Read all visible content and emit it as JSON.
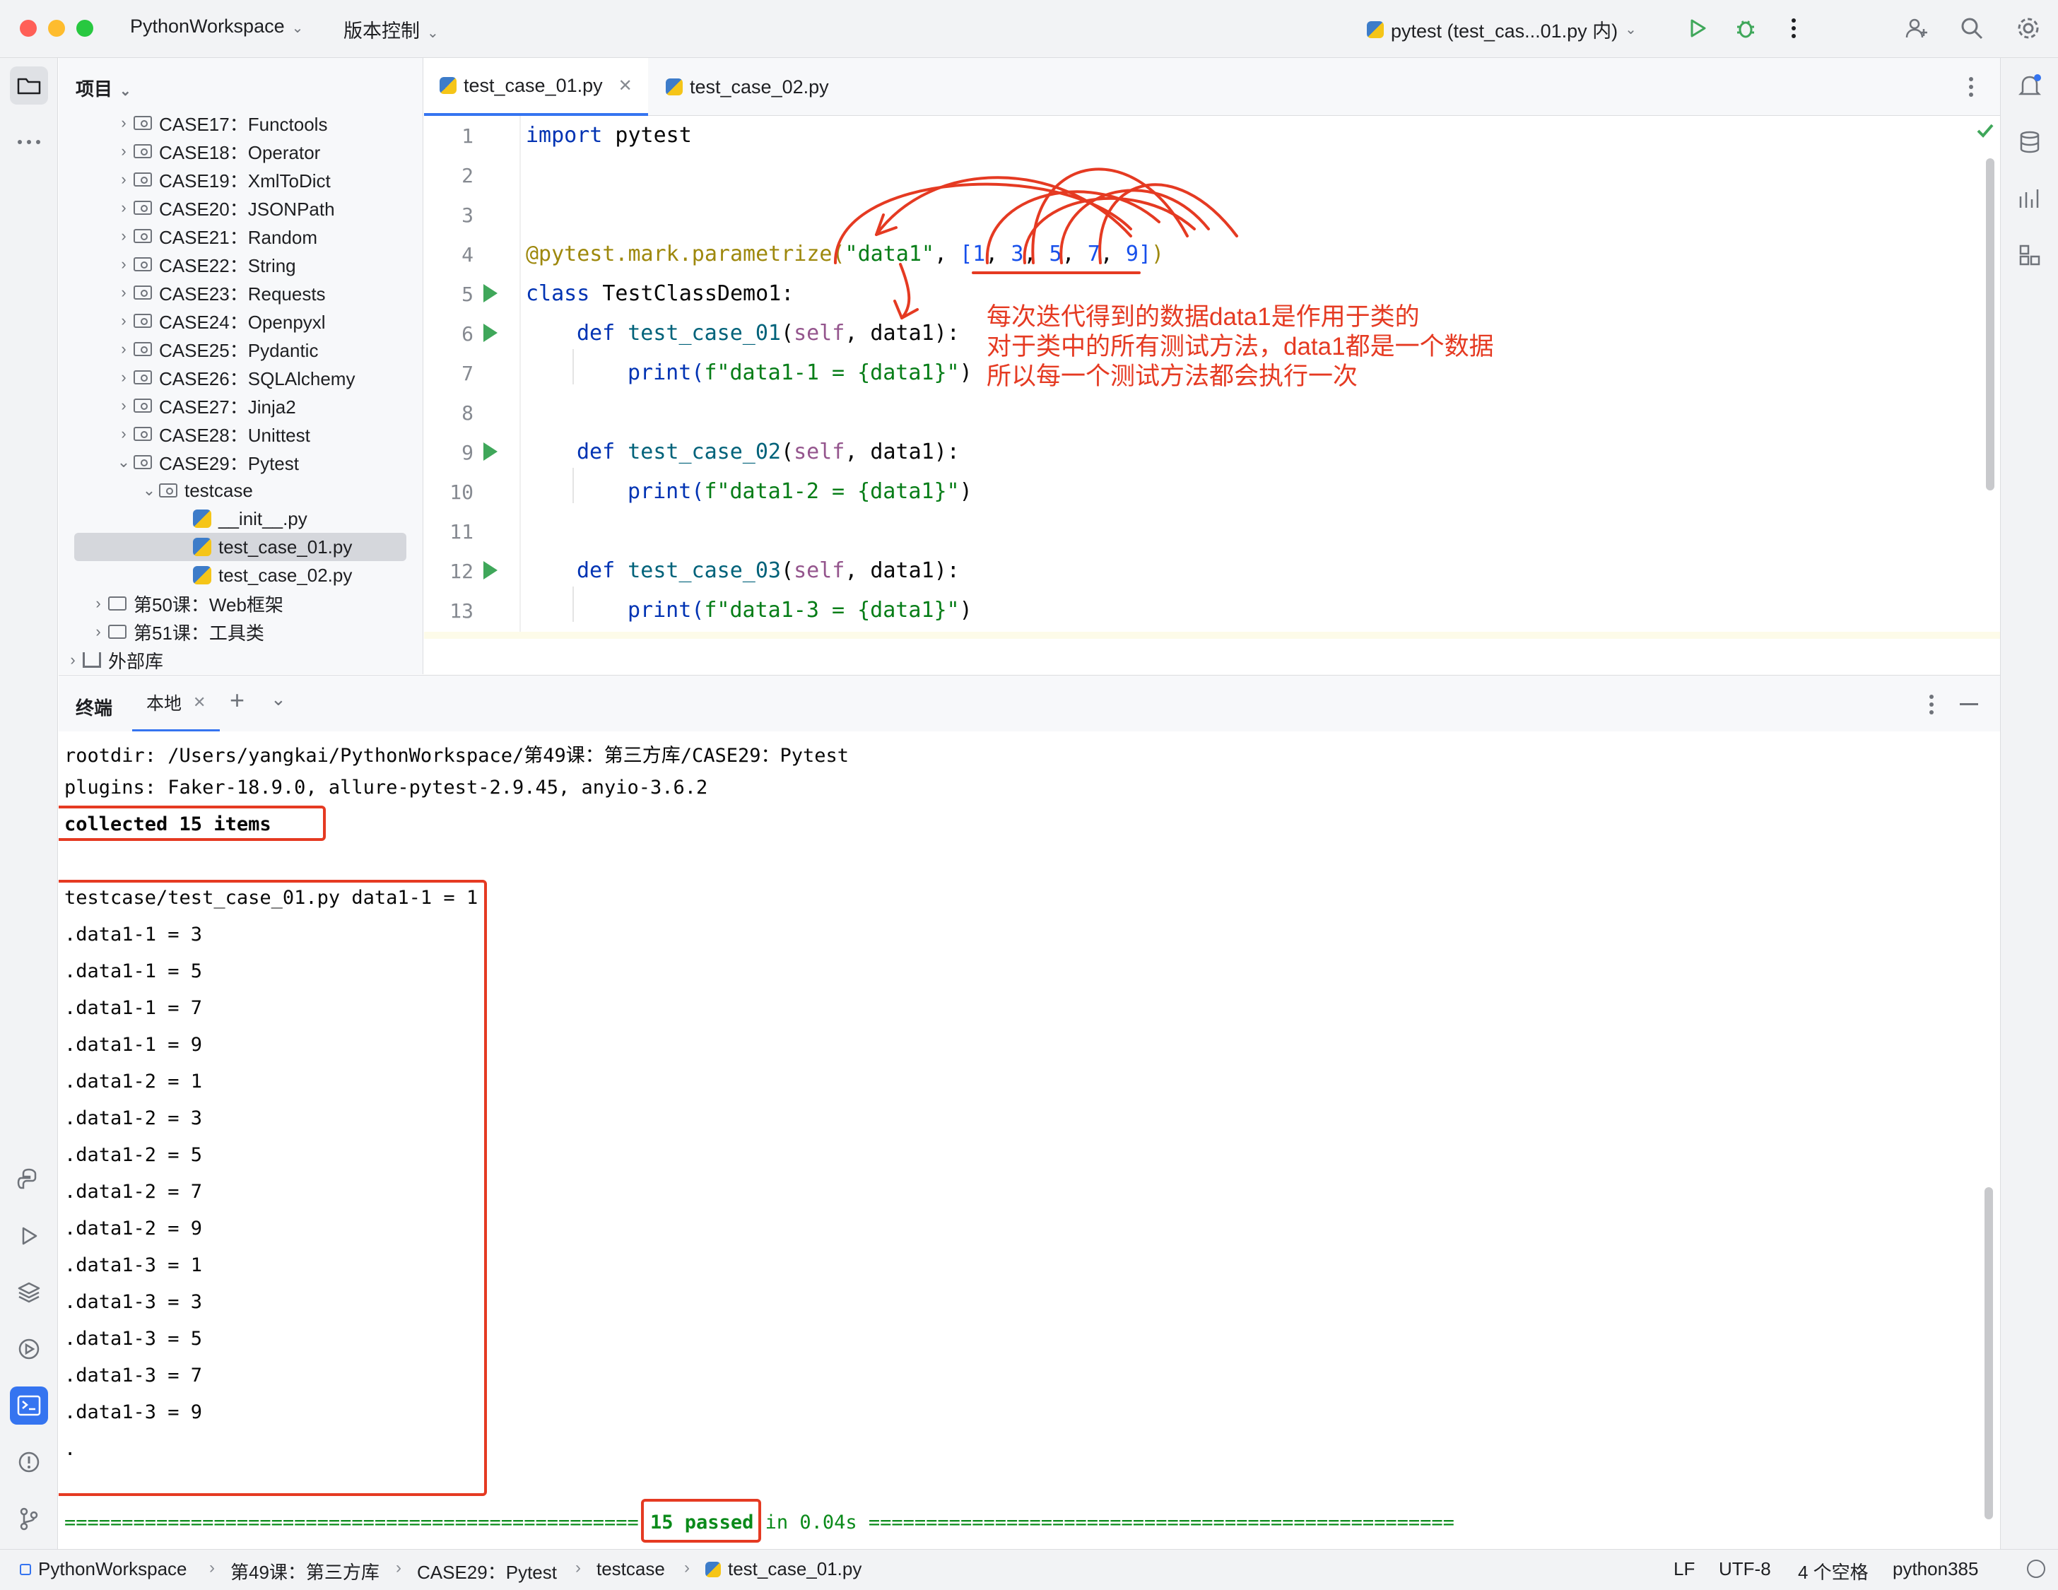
{
  "titlebar": {
    "project_name": "PythonWorkspace",
    "vcs_label": "版本控制",
    "run_config": "pytest (test_cas...01.py 内)"
  },
  "project_panel": {
    "title": "项目",
    "items": [
      {
        "label": "CASE17：Functools"
      },
      {
        "label": "CASE18：Operator"
      },
      {
        "label": "CASE19：XmlToDict"
      },
      {
        "label": "CASE20：JSONPath"
      },
      {
        "label": "CASE21：Random"
      },
      {
        "label": "CASE22：String"
      },
      {
        "label": "CASE23：Requests"
      },
      {
        "label": "CASE24：Openpyxl"
      },
      {
        "label": "CASE25：Pydantic"
      },
      {
        "label": "CASE26：SQLAlchemy"
      },
      {
        "label": "CASE27：Jinja2"
      },
      {
        "label": "CASE28：Unittest"
      },
      {
        "label": "CASE29：Pytest"
      },
      {
        "label": "testcase"
      },
      {
        "label": "__init__.py"
      },
      {
        "label": "test_case_01.py"
      },
      {
        "label": "test_case_02.py"
      },
      {
        "label": "第50课：Web框架"
      },
      {
        "label": "第51课：工具类"
      },
      {
        "label": "外部库"
      }
    ]
  },
  "editor": {
    "tabs": [
      {
        "label": "test_case_01.py"
      },
      {
        "label": "test_case_02.py"
      }
    ],
    "line_numbers": [
      "1",
      "2",
      "3",
      "4",
      "5",
      "6",
      "7",
      "8",
      "9",
      "10",
      "11",
      "12",
      "13"
    ],
    "code": {
      "l1_kw": "import",
      "l1_rest": " pytest",
      "l4_dec": "@pytest.mark.parametrize(",
      "l4_str": "\"data1\"",
      "l4_comma": ", ",
      "l4_lb": "[",
      "l4_n1": "1",
      "l4_n2": "3",
      "l4_n3": "5",
      "l4_n4": "7",
      "l4_n5": "9",
      "l4_rb": "]",
      "l4_end": ")",
      "l4_sep": ", ",
      "l5_kw": "class",
      "l5_rest": " TestClassDemo1:",
      "def_kw": "def",
      "l6_fn": "test_case_01",
      "l9_fn": "test_case_02",
      "l12_fn": "test_case_03",
      "self_kw": "self",
      "args_open": "(",
      "args_close": ", data1):",
      "print_fn": "print(",
      "l7_str": "f\"data1-1 = {data1}\"",
      "l10_str": "f\"data1-2 = {data1}\"",
      "l13_str": "f\"data1-3 = {data1}\"",
      "print_close": ")"
    },
    "annotation": [
      "每次迭代得到的数据data1是作用于类的",
      "对于类中的所有测试方法，data1都是一个数据",
      "所以每一个测试方法都会执行一次"
    ]
  },
  "terminal": {
    "tab_title": "终端",
    "tab_local": "本地",
    "lines": [
      "rootdir: /Users/yangkai/PythonWorkspace/第49课：第三方库/CASE29：Pytest",
      "plugins: Faker-18.9.0, allure-pytest-2.9.45, anyio-3.6.2",
      "collected 15 items",
      "",
      "testcase/test_case_01.py data1-1 = 1",
      ".data1-1 = 3",
      ".data1-1 = 5",
      ".data1-1 = 7",
      ".data1-1 = 9",
      ".data1-2 = 1",
      ".data1-2 = 3",
      ".data1-2 = 5",
      ".data1-2 = 7",
      ".data1-2 = 9",
      ".data1-3 = 1",
      ".data1-3 = 3",
      ".data1-3 = 5",
      ".data1-3 = 7",
      ".data1-3 = 9",
      "."
    ],
    "summary_left": "================================================== ",
    "summary_passed": "15 passed",
    "summary_right": " in 0.04s ==================================================="
  },
  "statusbar": {
    "breadcrumbs": [
      "PythonWorkspace",
      "第49课：第三方库",
      "CASE29：Pytest",
      "testcase",
      "test_case_01.py"
    ],
    "line_sep": "LF",
    "encoding": "UTF-8",
    "indent": "4 个空格",
    "interpreter": "python385"
  },
  "colors": {
    "accent": "#3574f0",
    "annotation_red": "#e53a22",
    "run_green": "#3fa75a",
    "passed_green": "#0a8a1a"
  }
}
